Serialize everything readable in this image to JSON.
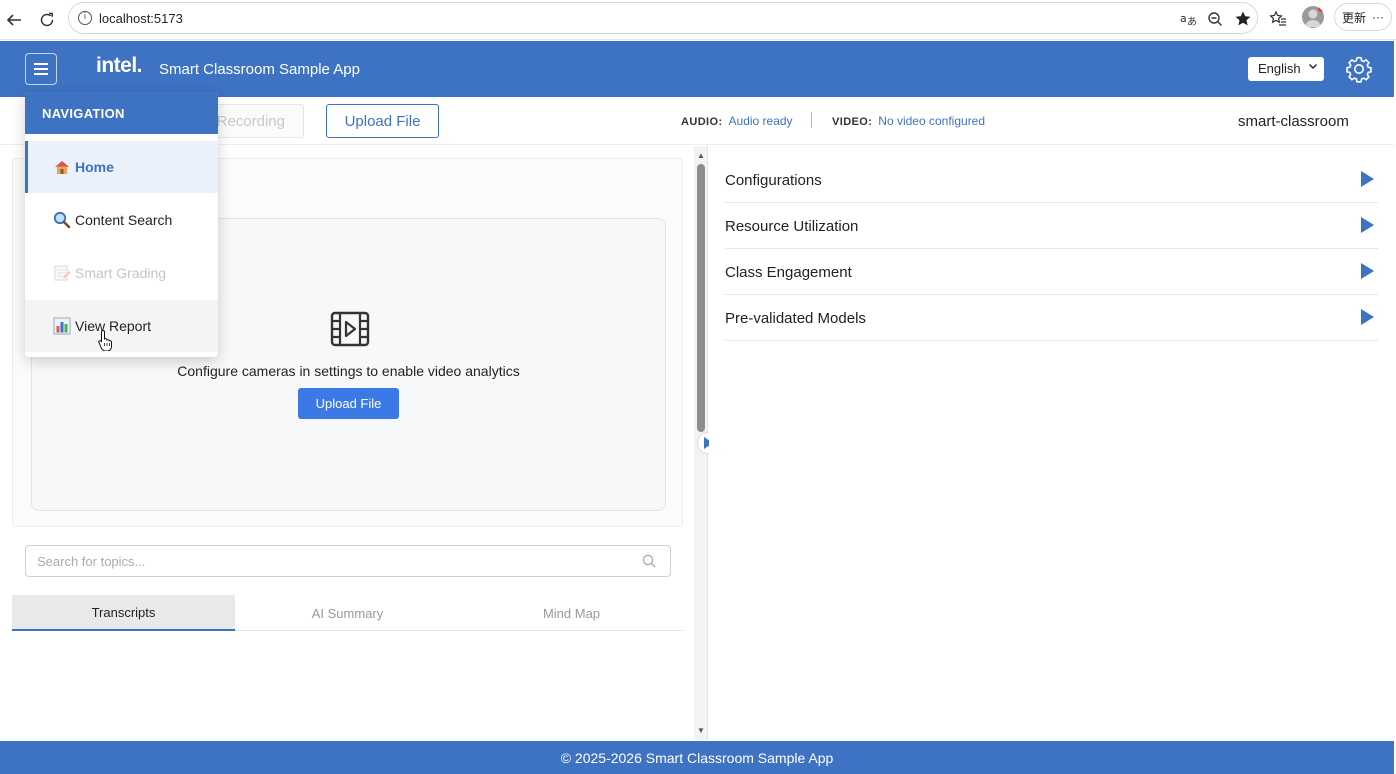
{
  "browser": {
    "url": "localhost:5173",
    "update_label": "更新",
    "more_label": "···"
  },
  "header": {
    "logo": "intel.",
    "title": "Smart Classroom Sample App",
    "language": "English"
  },
  "toolbar": {
    "recording_label": "Recording",
    "upload_label": "Upload File",
    "audio_key": "AUDIO:",
    "audio_value": "Audio ready",
    "video_key": "VIDEO:",
    "video_value": "No video configured",
    "class_name": "smart-classroom"
  },
  "video": {
    "message": "Configure cameras in settings to enable video analytics",
    "upload_label": "Upload File"
  },
  "search": {
    "placeholder": "Search for topics..."
  },
  "tabs": [
    {
      "label": "Transcripts",
      "active": true
    },
    {
      "label": "AI Summary",
      "active": false
    },
    {
      "label": "Mind Map",
      "active": false
    }
  ],
  "accordion": [
    {
      "label": "Configurations"
    },
    {
      "label": "Resource Utilization"
    },
    {
      "label": "Class Engagement"
    },
    {
      "label": "Pre-validated Models"
    }
  ],
  "navigation": {
    "header": "NAVIGATION",
    "items": [
      {
        "label": "Home",
        "icon": "house-icon",
        "state": "active"
      },
      {
        "label": "Content Search",
        "icon": "magnifier-icon",
        "state": "normal"
      },
      {
        "label": "Smart Grading",
        "icon": "memo-icon",
        "state": "disabled"
      },
      {
        "label": "View Report",
        "icon": "bar-chart-icon",
        "state": "hover"
      }
    ]
  },
  "footer": {
    "text": "© 2025-2026 Smart Classroom Sample App"
  },
  "colors": {
    "brand": "#3e72c2",
    "button_primary": "#3b7ae6"
  }
}
